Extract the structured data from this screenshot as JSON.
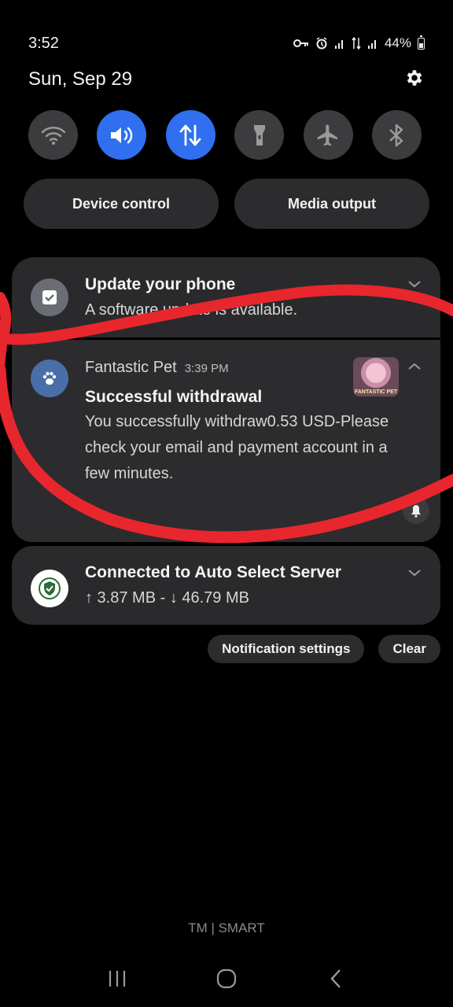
{
  "status": {
    "time": "3:52",
    "battery": "44%"
  },
  "date": "Sun, Sep 29",
  "quick_settings": [
    {
      "name": "wifi",
      "active": false
    },
    {
      "name": "sound",
      "active": true
    },
    {
      "name": "mobile-data",
      "active": true
    },
    {
      "name": "flashlight",
      "active": false
    },
    {
      "name": "airplane-mode",
      "active": false
    },
    {
      "name": "bluetooth",
      "active": false
    }
  ],
  "pills": {
    "device_control": "Device control",
    "media_output": "Media output"
  },
  "notifications": {
    "update": {
      "title": "Update your phone",
      "text": "A software update is available."
    },
    "pet": {
      "app": "Fantastic Pet",
      "time": "3:39 PM",
      "title": "Successful withdrawal",
      "body": "You successfully withdraw0.53 USD-Please check your email and payment account in a few minutes.",
      "thumb_text": "FANTASTIC PET"
    },
    "vpn": {
      "title": "Connected to Auto Select Server",
      "text": "↑ 3.87 MB - ↓ 46.79 MB"
    }
  },
  "actions": {
    "settings": "Notification settings",
    "clear": "Clear"
  },
  "carrier": "TM | SMART",
  "colors": {
    "accent": "#2f6ff0",
    "scribble": "#e8262d"
  }
}
